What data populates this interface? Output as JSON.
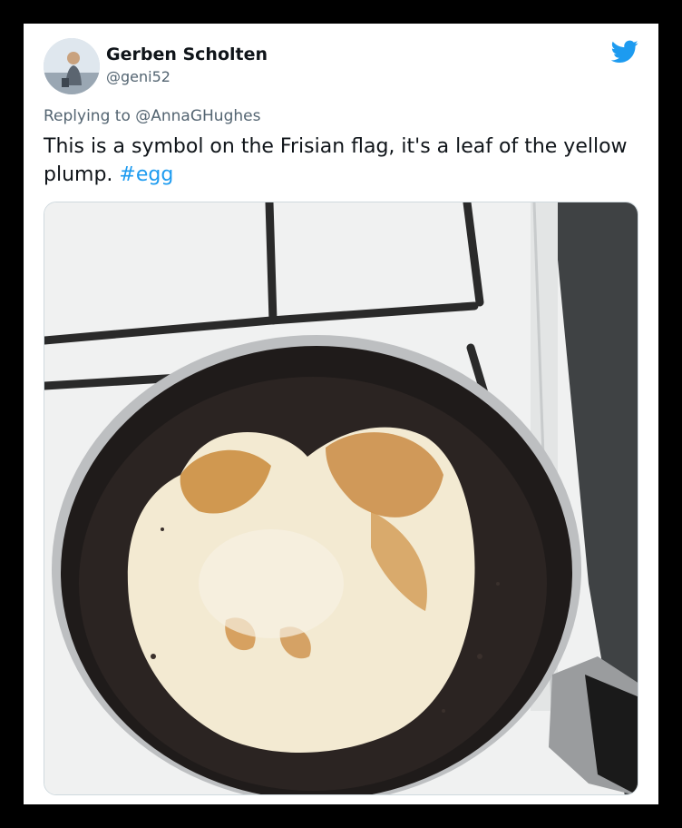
{
  "tweet": {
    "author_name": "Gerben Scholten",
    "author_handle": "@geni52",
    "reply_prefix": "Replying to",
    "reply_to": "@AnnaGHughes",
    "text": "This is a symbol on the Frisian flag, it's a leaf of the yellow plump.",
    "hashtag": "#egg"
  },
  "icons": {
    "logo": "twitter-bird-icon"
  },
  "colors": {
    "brand": "#1d9bf0",
    "name": "#0f1419",
    "secondary": "#536471"
  },
  "photo": {
    "subject": "heart-shaped-fried-egg-in-pan"
  }
}
